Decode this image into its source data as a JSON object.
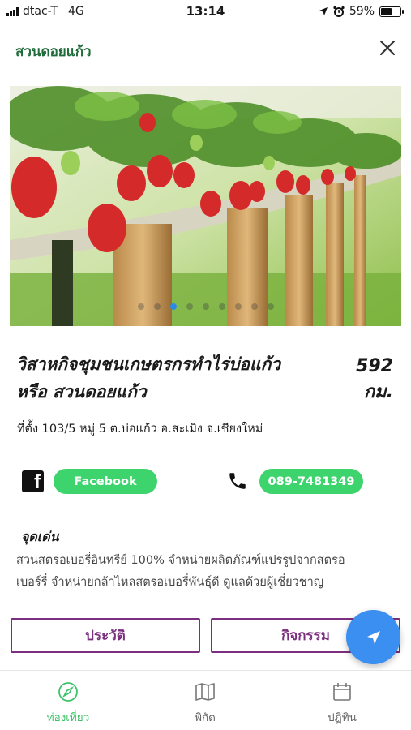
{
  "status_bar": {
    "carrier": "dtac-T",
    "network": "4G",
    "time": "13:14",
    "battery": "59%",
    "battery_level": 0.59
  },
  "header": {
    "title": "สวนดอยแก้ว"
  },
  "carousel": {
    "page_count": 9,
    "active_page": 3
  },
  "place": {
    "title_line1": "วิสาหกิจชุมชนเกษตรกรทำไร่บ่อแก้ว",
    "title_line2": "หรือ สวนดอยแก้ว",
    "distance_value": "592",
    "distance_unit": "กม.",
    "address": "ที่ตั้ง 103/5 หมู่ 5 ต.บ่อแก้ว อ.สะเมิง จ.เชียงใหม่"
  },
  "contact": {
    "facebook_label": "Facebook",
    "phone_label": "089-7481349"
  },
  "highlights": {
    "title": "จุดเด่น",
    "text_line1": "สวนสตรอเบอรี่อินทรีย์ 100% จำหน่ายผลิตภัณฑ์แปรรูปจากสตรอ",
    "text_line2": "เบอร์รี่ จำหน่ายกล้าไหลสตรอเบอรี่พันธุ์ดี ดูแลด้วยผู้เชี่ยวชาญ"
  },
  "actions": {
    "history_label": "ประวัติ",
    "activity_label": "กิจกรรม"
  },
  "tabbar": {
    "items": [
      {
        "label": "ท่องเที่ยว",
        "icon": "compass-icon",
        "active": true
      },
      {
        "label": "พิกัด",
        "icon": "map-icon",
        "active": false
      },
      {
        "label": "ปฏิทิน",
        "icon": "calendar-icon",
        "active": false
      }
    ]
  },
  "colors": {
    "brand_green": "#1f6b3a",
    "pill_green": "#3dd46d",
    "accent_purple": "#7b2f7e",
    "fab_blue": "#3b8ff0"
  }
}
